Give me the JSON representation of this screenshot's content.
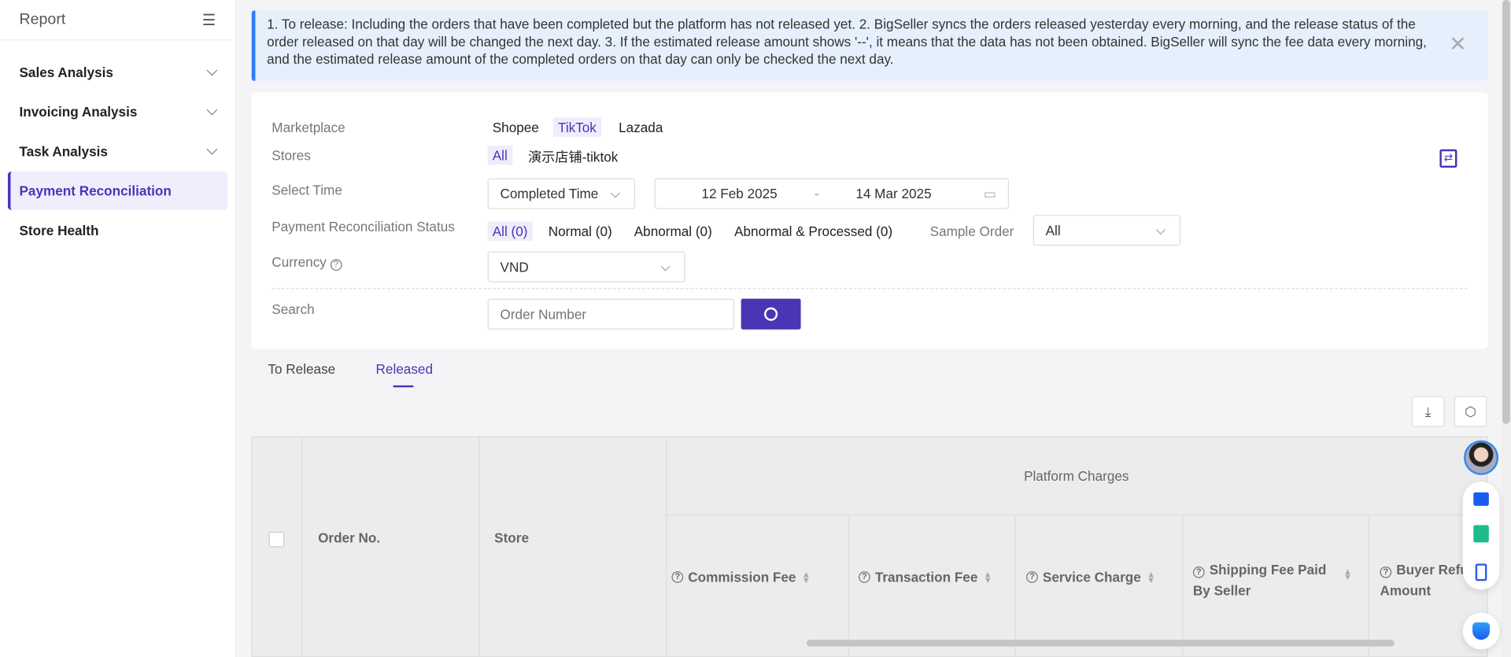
{
  "sidebar": {
    "title": "Report",
    "items": [
      {
        "label": "Sales Analysis"
      },
      {
        "label": "Invoicing Analysis"
      },
      {
        "label": "Task Analysis"
      },
      {
        "label": "Payment Reconciliation"
      },
      {
        "label": "Store Health"
      }
    ]
  },
  "notice": "1. To release: Including the orders that have been completed but the platform has not released yet.  2. BigSeller syncs the orders released yesterday every morning, and the release status of the order released on that day will be changed the next day.  3. If the estimated release amount shows '--', it means that the data has not been obtained. BigSeller will sync the fee data every morning, and the estimated release amount of the completed orders on that day can only be checked the next day.",
  "filters": {
    "marketplace_label": "Marketplace",
    "marketplaces": [
      "Shopee",
      "TikTok",
      "Lazada"
    ],
    "stores_label": "Stores",
    "stores": [
      "All",
      "演示店铺-tiktok"
    ],
    "time_label": "Select Time",
    "time_type": "Completed Time",
    "date_from": "12 Feb 2025",
    "date_sep": "-",
    "date_to": "14 Mar 2025",
    "status_label": "Payment Reconciliation Status",
    "statuses": [
      "All (0)",
      "Normal (0)",
      "Abnormal (0)",
      "Abnormal & Processed (0)"
    ],
    "sample_label": "Sample Order",
    "sample_value": "All",
    "currency_label": "Currency",
    "currency_value": "VND",
    "search_label": "Search",
    "search_placeholder": "Order Number"
  },
  "tabs": [
    "To Release",
    "Released"
  ],
  "table": {
    "order_no": "Order No.",
    "store": "Store",
    "group": "Platform Charges",
    "columns": [
      "Commission Fee",
      "Transaction Fee",
      "Service Charge",
      "Shipping Fee Paid By Seller",
      "Buyer Refund Amount"
    ]
  },
  "colors": {
    "accent": "#4a35b5",
    "notice_bg": "#e6f0fd",
    "notice_border": "#2f7cf6"
  }
}
